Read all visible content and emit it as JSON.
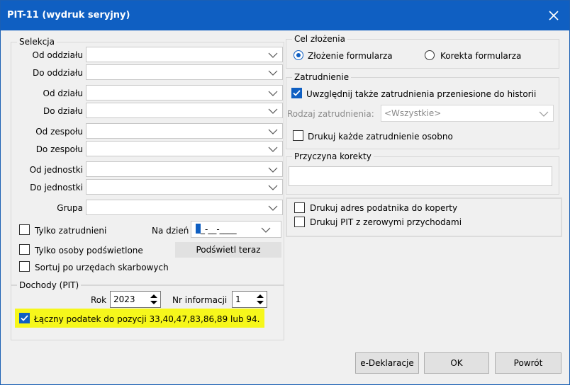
{
  "window": {
    "title": "PIT-11 (wydruk seryjny)"
  },
  "selekcja": {
    "title": "Selekcja",
    "fields": [
      {
        "label": "Od oddziału",
        "value": ""
      },
      {
        "label": "Do oddziału",
        "value": ""
      },
      {
        "label": "Od działu",
        "value": ""
      },
      {
        "label": "Do działu",
        "value": ""
      },
      {
        "label": "Od zespołu",
        "value": ""
      },
      {
        "label": "Do zespołu",
        "value": ""
      },
      {
        "label": "Od jednostki",
        "value": ""
      },
      {
        "label": "Do jednostki",
        "value": ""
      },
      {
        "label": "Grupa",
        "value": ""
      }
    ],
    "tylko_zatrudnieni": {
      "label": "Tylko zatrudnieni",
      "checked": false
    },
    "na_dzien": {
      "label": "Na dzień",
      "value": "_-__-____"
    },
    "tylko_podswietlone": {
      "label": "Tylko osoby podświetlone",
      "checked": false
    },
    "podswietl_button": "Podświetl teraz",
    "sortuj": {
      "label": "Sortuj po urzędach skarbowych",
      "checked": false
    }
  },
  "dochody": {
    "title": "Dochody (PIT)",
    "rok_label": "Rok",
    "rok_value": "2023",
    "nr_label": "Nr informacji",
    "nr_value": "1",
    "laczny": {
      "label": "Łączny podatek do pozycji 33,40,47,83,86,89 lub 94.",
      "checked": true
    }
  },
  "cel": {
    "title": "Cel złożenia",
    "option1": {
      "label": "Złożenie formularza",
      "selected": true
    },
    "option2": {
      "label": "Korekta formularza",
      "selected": false
    }
  },
  "zatrudnienie": {
    "title": "Zatrudnienie",
    "uwzglednij": {
      "label": "Uwzględnij także zatrudnienia przeniesione do historii",
      "checked": true
    },
    "rodzaj_label": "Rodzaj zatrudnienia:",
    "rodzaj_value": "<Wszystkie>",
    "drukuj_kazde": {
      "label": "Drukuj każde zatrudnienie osobno",
      "checked": false
    }
  },
  "przyczyna": {
    "title": "Przyczyna korekty",
    "value": ""
  },
  "opcje": {
    "adres": {
      "label": "Drukuj adres podatnika do koperty",
      "checked": false
    },
    "zerowe": {
      "label": "Drukuj PIT z zerowymi przychodami",
      "checked": false
    }
  },
  "buttons": {
    "edeklaracje": "e-Deklaracje",
    "ok": "OK",
    "powrot": "Powrót"
  },
  "colors": {
    "titlebar": "#0f5fc2",
    "highlight": "#f6f71b",
    "accent": "#0f5fc2"
  }
}
